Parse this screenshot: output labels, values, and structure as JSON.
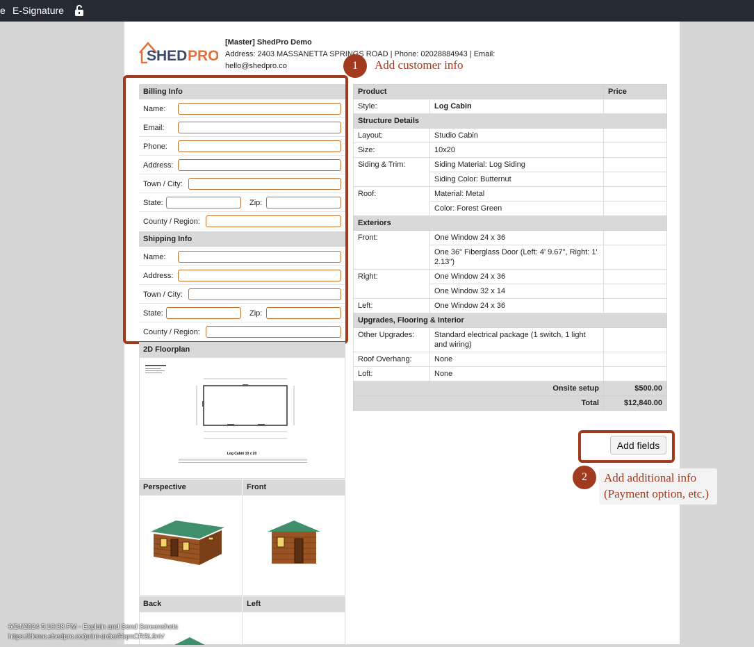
{
  "window": {
    "edge_char": "e",
    "title": "E-Signature",
    "lock_icon": "unlock-icon"
  },
  "company": {
    "logo_text_1": "SHED",
    "logo_text_2": "PRO",
    "name": "[Master] ShedPro Demo",
    "address_line": "Address: 2403 MASSANETTA SPRINGS ROAD | Phone: 02028884943 | Email:",
    "email": "hello@shedpro.co"
  },
  "billing": {
    "title": "Billing Info",
    "name_label": "Name:",
    "name_value": "",
    "email_label": "Email:",
    "email_value": "",
    "phone_label": "Phone:",
    "phone_value": "",
    "address_label": "Address:",
    "address_value": "",
    "town_label": "Town / City:",
    "town_value": "",
    "state_label": "State:",
    "state_value": "",
    "zip_label": "Zip:",
    "zip_value": "",
    "county_label": "County / Region:",
    "county_value": ""
  },
  "shipping": {
    "title": "Shipping Info",
    "name_label": "Name:",
    "name_value": "",
    "address_label": "Address:",
    "address_value": "",
    "town_label": "Town / City:",
    "town_value": "",
    "state_label": "State:",
    "state_value": "",
    "zip_label": "Zip:",
    "zip_value": "",
    "county_label": "County / Region:",
    "county_value": ""
  },
  "order": {
    "col_product": "Product",
    "col_price": "Price",
    "style_label": "Style:",
    "style_value": "Log Cabin",
    "structure_title": "Structure Details",
    "layout_label": "Layout:",
    "layout_value": "Studio Cabin",
    "size_label": "Size:",
    "size_value": "10x20",
    "siding_label": "Siding & Trim:",
    "siding_material": "Siding Material: Log Siding",
    "siding_color": "Siding Color: Butternut",
    "roof_label": "Roof:",
    "roof_material": "Material: Metal",
    "roof_color": "Color: Forest Green",
    "exteriors_title": "Exteriors",
    "front_label": "Front:",
    "front_1": "One Window 24 x 36",
    "front_2": "One 36\" Fiberglass Door (Left: 4' 9.67\", Right: 1' 2.13\")",
    "right_label": "Right:",
    "right_1": "One Window 24 x 36",
    "right_2": "One Window 32 x 14",
    "left_label": "Left:",
    "left_1": "One Window 24 x 36",
    "upgrades_title": "Upgrades, Flooring & Interior",
    "other_label": "Other Upgrades:",
    "other_value": "Standard electrical package (1 switch, 1 light and wiring)",
    "overhang_label": "Roof Overhang:",
    "overhang_value": "None",
    "loft_label": "Loft:",
    "loft_value": "None",
    "onsite_label": "Onsite setup",
    "onsite_value": "$500.00",
    "total_label": "Total",
    "total_value": "$12,840.00"
  },
  "add_fields_button": "Add fields",
  "callouts": [
    {
      "number": "1",
      "text": "Add customer info"
    },
    {
      "number": "2",
      "text_1": "Add additional info",
      "text_2": "(Payment option, etc.)"
    }
  ],
  "images": {
    "floorplan_title": "2D Floorplan",
    "floorplan_caption": "Log Cabin 10 x 20",
    "perspective_title": "Perspective",
    "front_title": "Front",
    "back_title": "Back",
    "left_title": "Left"
  },
  "footer": {
    "line_1": "6/24/2024 5:10:38 PM - Explain and Send Screenshots",
    "line_2": "https://demo.shedpro.co/print-order/HqmCRSL9nV"
  },
  "colors": {
    "callout": "#a23a1f",
    "field_border": "#c0702a",
    "header_bg": "#d9d9d9",
    "topbar": "#262b33"
  }
}
